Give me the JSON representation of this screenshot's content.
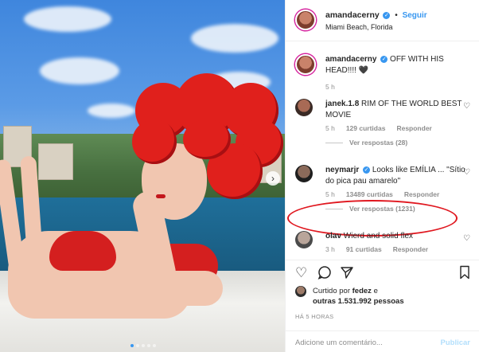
{
  "post": {
    "username": "amandacerny",
    "follow_label": "Seguir",
    "separator": "•",
    "location": "Miami Beach, Florida",
    "caption": "OFF WITH HIS HEAD!!!! 🖤",
    "caption_time": "5 h"
  },
  "comments": [
    {
      "username": "janek.1.8",
      "text": "RIM OF THE WORLD BEST MOVIE",
      "time": "5 h",
      "likes": "129 curtidas",
      "reply_label": "Responder",
      "view_replies": "Ver respostas (28)"
    },
    {
      "username": "neymarjr",
      "text": "Looks like EMÍLIA ... \"Sítio do pica pau amarelo\"",
      "time": "5 h",
      "likes": "13489 curtidas",
      "reply_label": "Responder",
      "view_replies": "Ver respostas (1231)"
    },
    {
      "username": "olav",
      "text": "Wierd and solid flex",
      "time": "3 h",
      "likes": "91 curtidas",
      "reply_label": "Responder"
    }
  ],
  "likes": {
    "prefix": "Curtido por",
    "by_user": "fedez",
    "connector": "e",
    "others": "outras 1.531.992 pessoas"
  },
  "timestamp": "HÁ 5 HORAS",
  "add_comment": {
    "placeholder": "Adicione um comentário...",
    "publish_label": "Publicar"
  },
  "icons": {
    "verified": "verified-badge-icon",
    "like": "heart-icon",
    "comment": "comment-bubble-icon",
    "share": "paper-plane-icon",
    "save": "bookmark-icon",
    "next": "chevron-right-icon"
  },
  "colors": {
    "accent": "#3897f0",
    "highlight": "#e0171f",
    "hair": "#e0201c"
  }
}
